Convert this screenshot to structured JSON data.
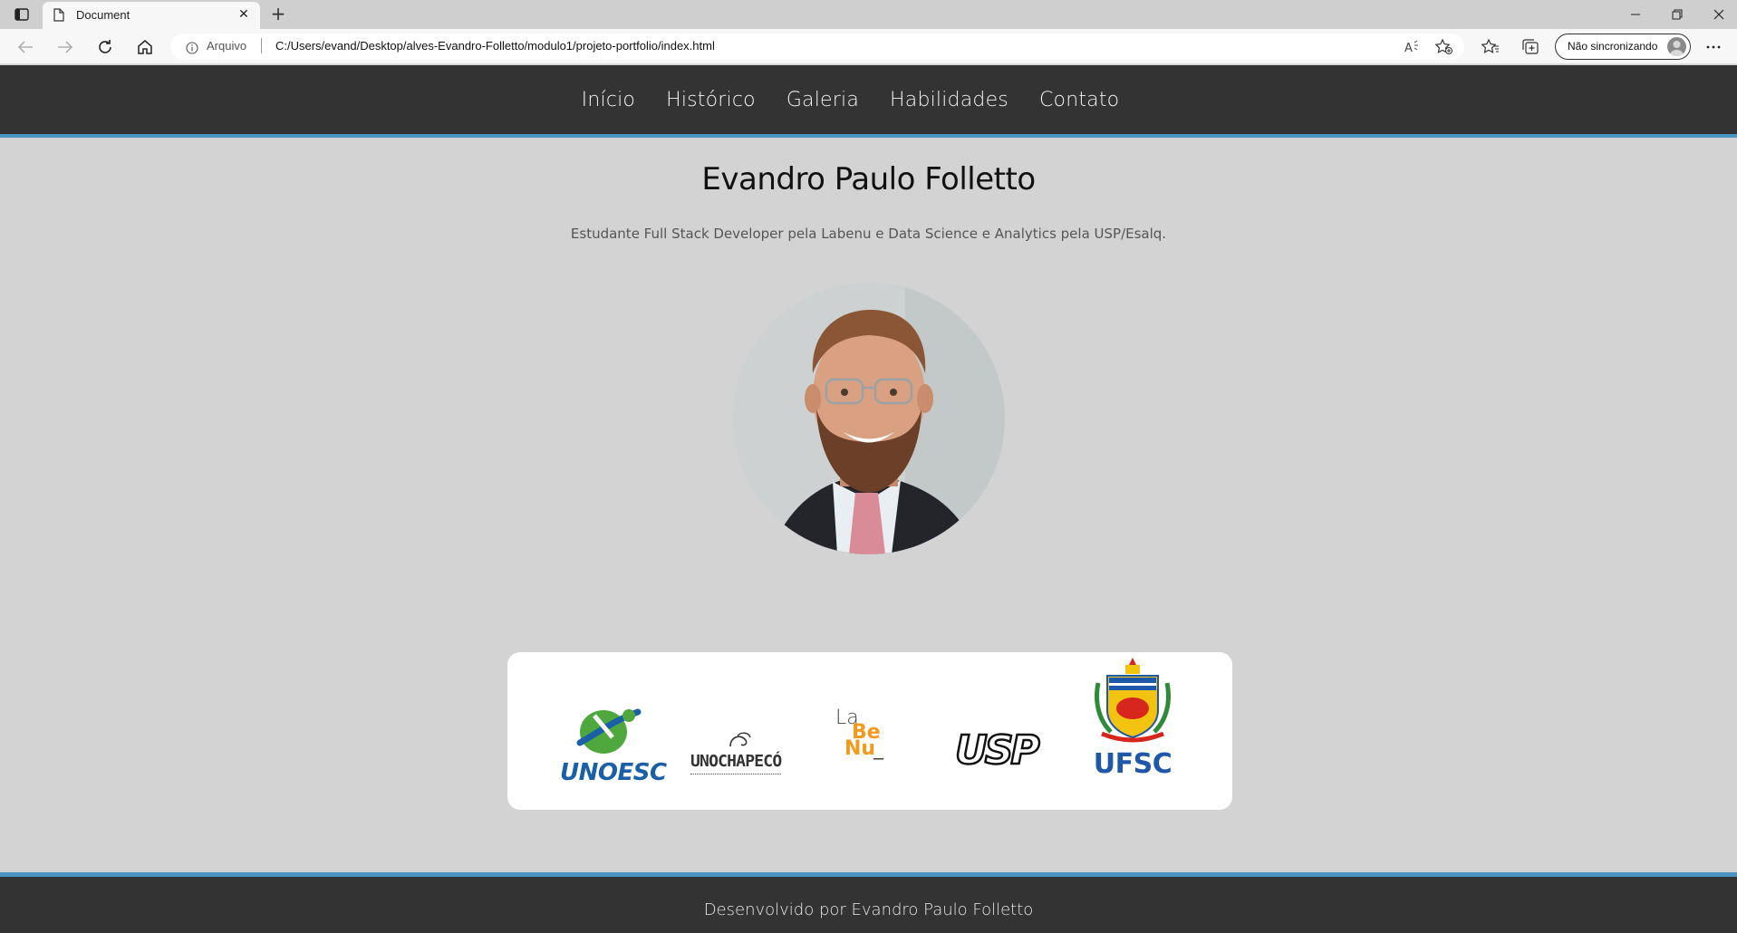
{
  "browser": {
    "tab": {
      "title": "Document"
    },
    "new_tab_symbol": "+",
    "address": {
      "scheme_label": "Arquivo",
      "url": "C:/Users/evand/Desktop/alves-Evandro-Folletto/modulo1/projeto-portfolio/index.html"
    },
    "profile": {
      "sync_label": "Não sincronizando"
    }
  },
  "site": {
    "nav": {
      "items": [
        {
          "label": "Início"
        },
        {
          "label": "Histórico"
        },
        {
          "label": "Galeria"
        },
        {
          "label": "Habilidades"
        },
        {
          "label": "Contato"
        }
      ]
    },
    "hero": {
      "name": "Evandro Paulo Folletto",
      "subtitle": "Estudante Full Stack Developer pela Labenu e Data Science e Analytics pela USP/Esalq."
    },
    "logos": {
      "unoesc": "UNOESC",
      "unochapeco": "UNOCHAPECÓ",
      "labenu": [
        "La",
        "Be",
        "Nu",
        "_"
      ],
      "usp": "USP",
      "ufsc": "UFSC"
    },
    "footer": {
      "text": "Desenvolvido por Evandro Paulo Folletto"
    }
  },
  "colors": {
    "header_bg": "#333333",
    "accent_blue": "#4a95c3",
    "page_bg": "#d3d3d3",
    "unoesc_green": "#4fa83d",
    "unoesc_blue": "#1b5fa6",
    "labenu_orange": "#f39a1e",
    "ufsc_blue": "#1f58a8"
  }
}
